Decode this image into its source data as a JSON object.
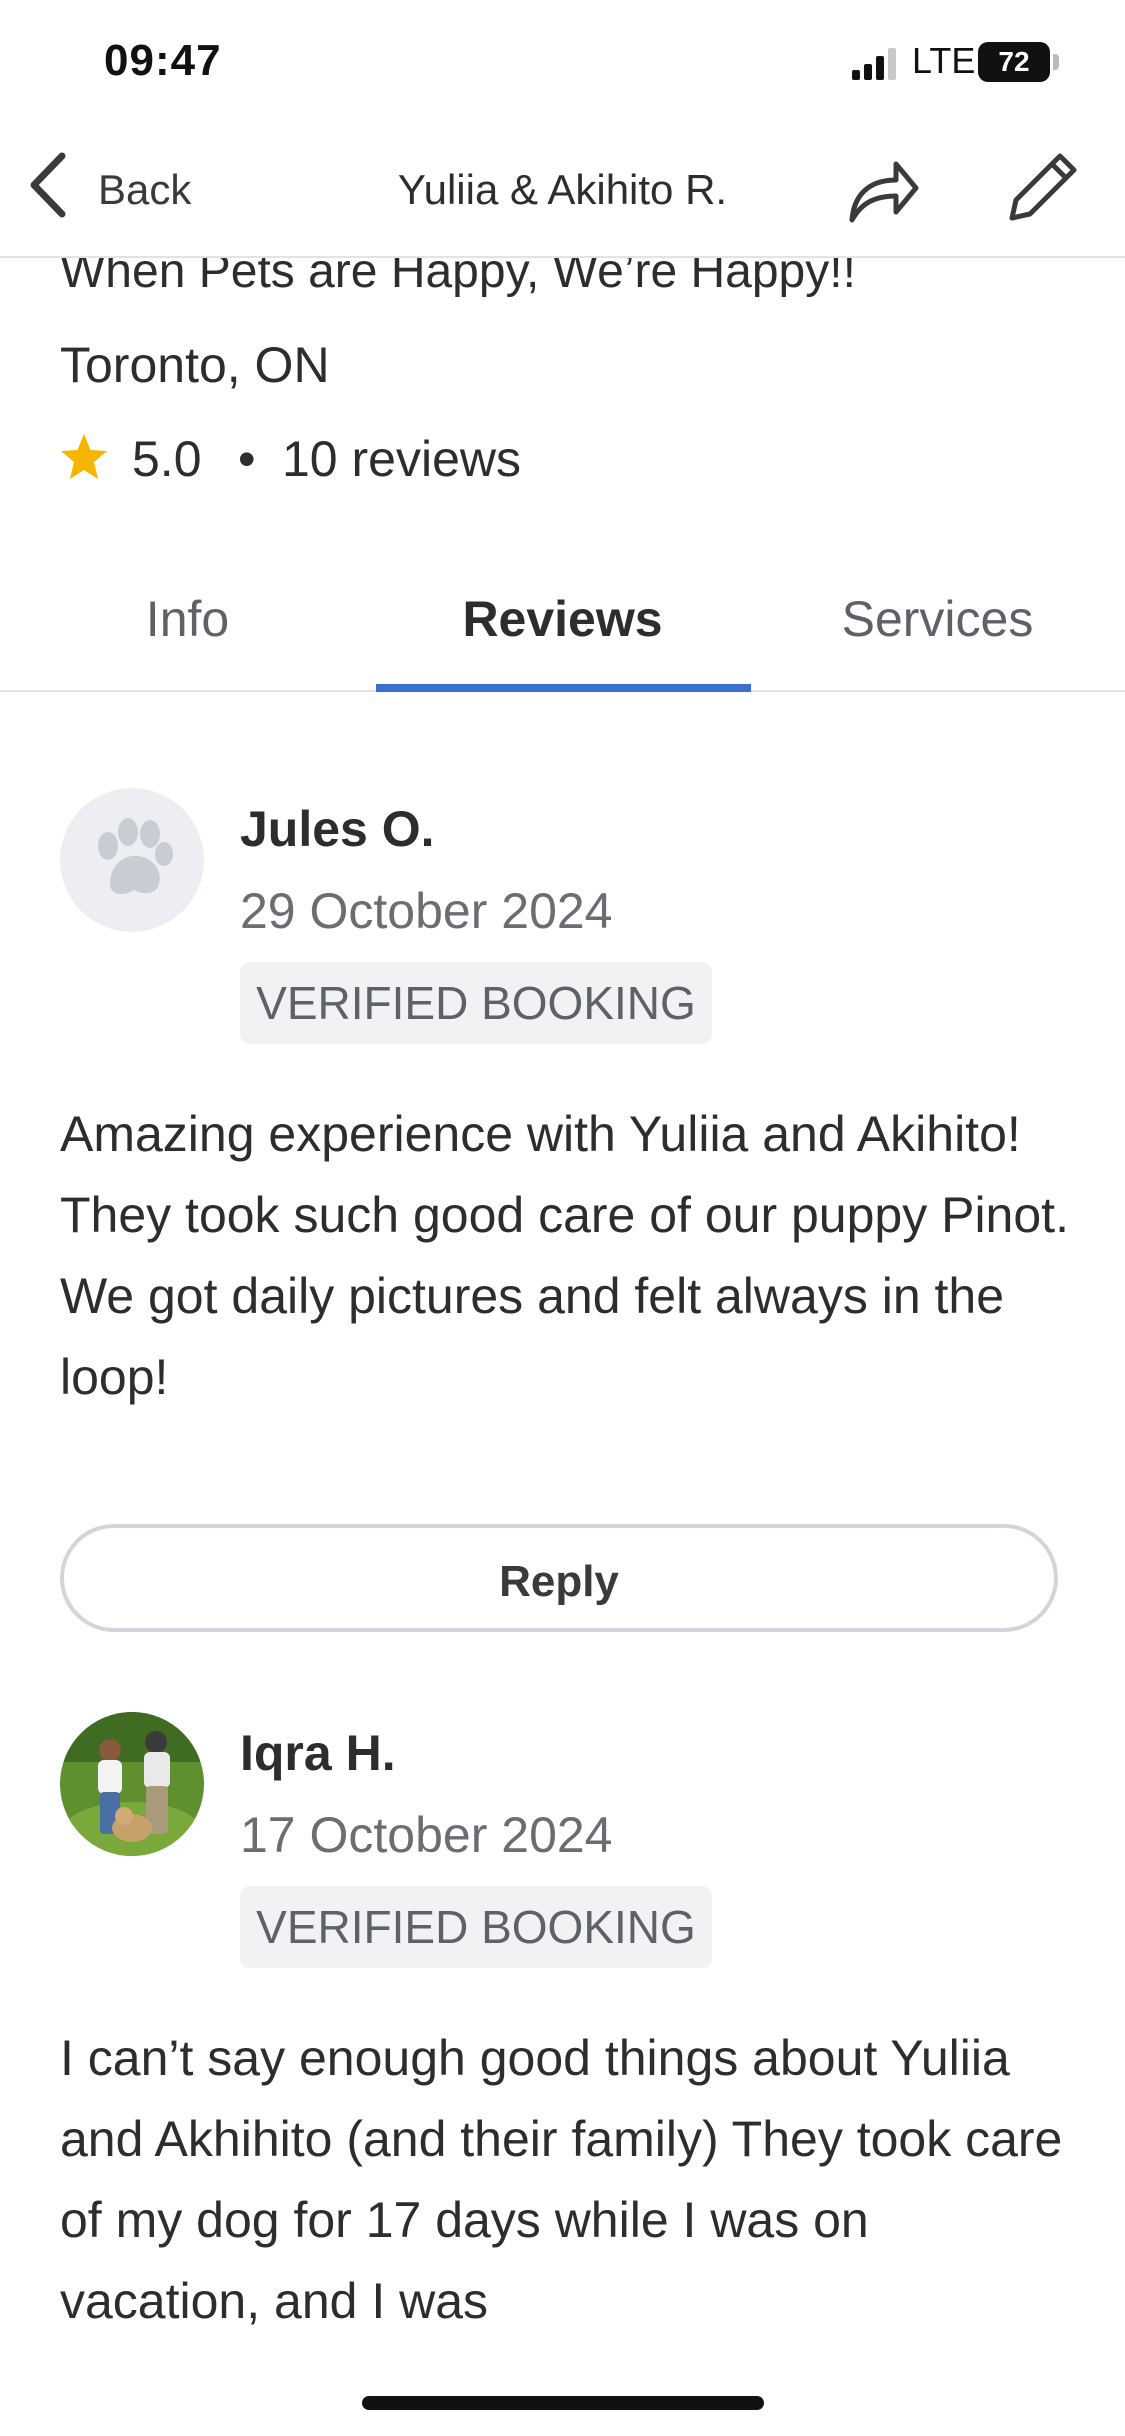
{
  "status_bar": {
    "time": "09:47",
    "network": "LTE",
    "battery": "72"
  },
  "nav": {
    "back_label": "Back",
    "title": "Yuliia & Akihito R."
  },
  "profile": {
    "tagline": "When Pets are Happy, We’re Happy!!",
    "location": "Toronto, ON",
    "rating": "5.0",
    "separator": "•",
    "reviews_count": "10 reviews"
  },
  "tabs": [
    {
      "label": "Info",
      "active": false
    },
    {
      "label": "Reviews",
      "active": true
    },
    {
      "label": "Services",
      "active": false
    }
  ],
  "reviews": [
    {
      "name": "Jules O.",
      "date": "29 October 2024",
      "badge": "VERIFIED BOOKING",
      "text": "Amazing experience with Yuliia and Akihito! They took such good care of our puppy Pinot. We got daily pictures and felt always in the loop!",
      "reply_label": "Reply",
      "avatar": "paw-icon"
    },
    {
      "name": "Iqra H.",
      "date": "17 October 2024",
      "badge": "VERIFIED BOOKING",
      "text": "I can’t say enough good things about Yuliia and Akhihito (and their family) They took care of my dog for 17 days while I was on vacation, and I was",
      "avatar": "photo"
    }
  ],
  "colors": {
    "accent": "#3a6fd0",
    "star": "#f7b500",
    "text": "#2d2d2f",
    "muted": "#6b6d73",
    "badge_bg": "#f1f2f4"
  }
}
